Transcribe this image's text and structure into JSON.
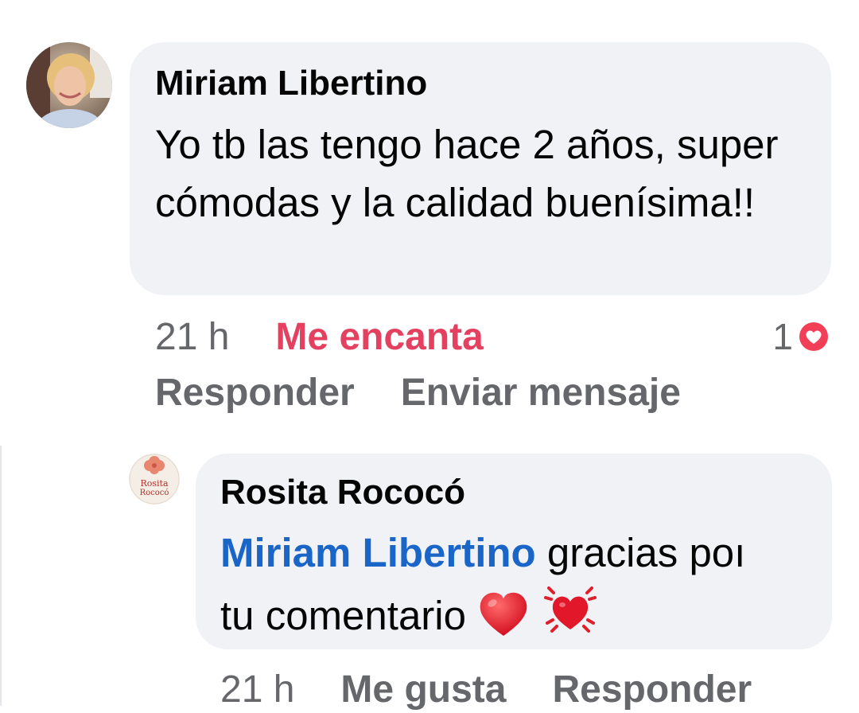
{
  "comment": {
    "author": "Miriam Libertino",
    "text": "Yo tb las tengo hace 2 años, super cómodas y la calidad buenísima!!",
    "time": "21 h",
    "reaction_label": "Me encanta",
    "reaction_count": "1",
    "reaction_icon": "heart-reaction-icon",
    "actions": {
      "reply": "Responder",
      "message": "Enviar mensaje"
    }
  },
  "reply": {
    "author": "Rosita Rococó",
    "avatar_text": [
      "Rosita",
      "Rococó"
    ],
    "mention": "Miriam Libertino",
    "text_line1": " gracias poı",
    "text_line2": "tu comentario",
    "emojis": [
      "red-heart-icon",
      "beating-heart-icon"
    ],
    "time": "21 h",
    "actions": {
      "like": "Me gusta",
      "reply": "Responder"
    }
  },
  "colors": {
    "bubble_bg": "#f0f2f5",
    "secondary_text": "#65676b",
    "love_red": "#e4405f",
    "mention_blue": "#1a66c8"
  }
}
